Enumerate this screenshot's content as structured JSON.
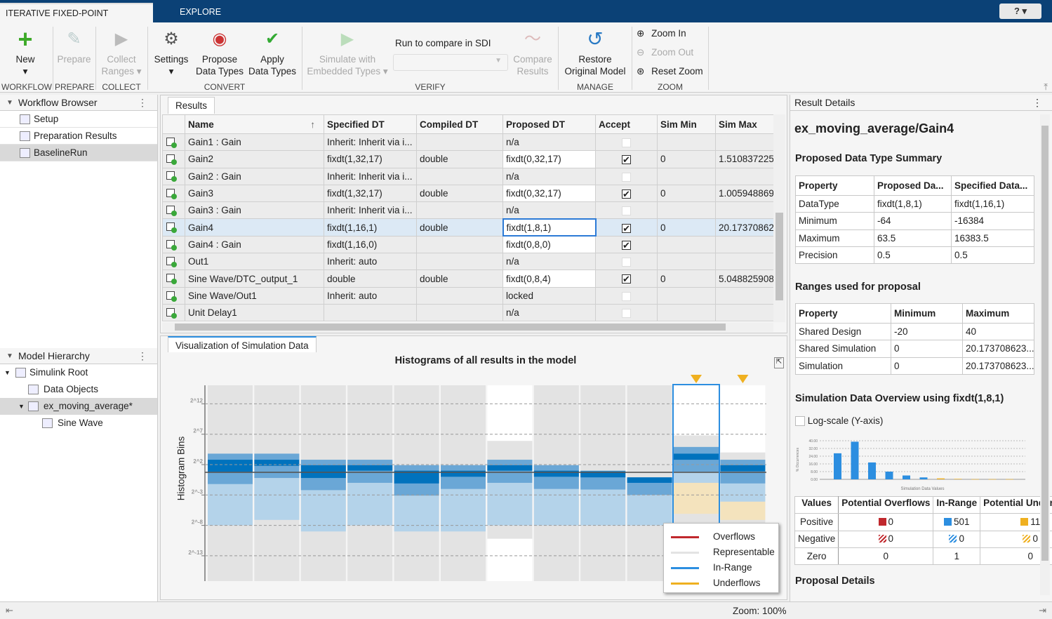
{
  "tabs": [
    "ITERATIVE FIXED-POINT CONVERSION",
    "EXPLORE"
  ],
  "help_icon": "question-icon",
  "toolstrip": {
    "buttons": [
      {
        "label1": "New",
        "label2": "▾",
        "enabled": true,
        "icon": "plus-icon"
      },
      {
        "label1": "Prepare",
        "label2": "",
        "enabled": false,
        "icon": "prepare-icon"
      },
      {
        "label1": "Collect",
        "label2": "Ranges ▾",
        "enabled": false,
        "icon": "collect-ranges-icon"
      },
      {
        "label1": "Settings",
        "label2": "▾",
        "enabled": true,
        "icon": "settings-icon"
      },
      {
        "label1": "Propose",
        "label2": "Data Types",
        "enabled": true,
        "icon": "propose-icon"
      },
      {
        "label1": "Apply",
        "label2": "Data Types",
        "enabled": true,
        "icon": "apply-icon"
      },
      {
        "label1": "Simulate with",
        "label2": "Embedded Types ▾",
        "enabled": false,
        "icon": "simulate-icon"
      },
      {
        "label1": "Compare",
        "label2": "Results",
        "enabled": false,
        "icon": "compare-icon"
      },
      {
        "label1": "Restore",
        "label2": "Original Model",
        "enabled": true,
        "icon": "restore-icon"
      }
    ],
    "run_compare_label": "Run to compare in SDI",
    "run_compare_value": "",
    "zoom": [
      "Zoom In",
      "Zoom Out",
      "Reset Zoom"
    ],
    "groups": [
      "WORKFLOW",
      "PREPARE",
      "COLLECT",
      "CONVERT",
      "VERIFY",
      "MANAGE",
      "ZOOM"
    ]
  },
  "workflow": {
    "title": "Workflow Browser",
    "items": [
      "Setup",
      "Preparation Results",
      "BaselineRun"
    ],
    "selected": 2
  },
  "hierarchy": {
    "title": "Model Hierarchy",
    "items": [
      "Simulink Root",
      "Data Objects",
      "ex_moving_average*",
      "Sine Wave"
    ],
    "selected": 2
  },
  "results": {
    "tab": "Results",
    "columns": [
      "Name",
      "Specified DT",
      "Compiled DT",
      "Proposed DT",
      "Accept",
      "Sim Min",
      "Sim Max"
    ],
    "rows": [
      [
        "Gain1 : Gain",
        "Inherit: Inherit via i...",
        "",
        "n/a",
        "disabled",
        "",
        ""
      ],
      [
        "Gain2",
        "fixdt(1,32,17)",
        "double",
        "fixdt(0,32,17)",
        "checked",
        "0",
        "1.510837225"
      ],
      [
        "Gain2 : Gain",
        "Inherit: Inherit via i...",
        "",
        "n/a",
        "disabled",
        "",
        ""
      ],
      [
        "Gain3",
        "fixdt(1,32,17)",
        "double",
        "fixdt(0,32,17)",
        "checked",
        "0",
        "1.005948869"
      ],
      [
        "Gain3 : Gain",
        "Inherit: Inherit via i...",
        "",
        "n/a",
        "disabled",
        "",
        ""
      ],
      [
        "Gain4",
        "fixdt(1,16,1)",
        "double",
        "fixdt(1,8,1)",
        "checked",
        "0",
        "20.17370862"
      ],
      [
        "Gain4 : Gain",
        "fixdt(1,16,0)",
        "",
        "fixdt(0,8,0)",
        "checked",
        "",
        ""
      ],
      [
        "Out1",
        "Inherit: auto",
        "",
        "n/a",
        "disabled",
        "",
        ""
      ],
      [
        "Sine Wave/DTC_output_1",
        "double",
        "double",
        "fixdt(0,8,4)",
        "checked",
        "0",
        "5.048825908"
      ],
      [
        "Sine Wave/Out1",
        "Inherit: auto",
        "",
        "locked",
        "disabled",
        "",
        ""
      ],
      [
        "Unit Delay1",
        "",
        "",
        "n/a",
        "disabled",
        "",
        ""
      ]
    ],
    "selected_row": 5
  },
  "viz": {
    "tab": "Visualization of Simulation Data",
    "chart_data": {
      "type": "bar",
      "title": "Histograms of all results in the model",
      "ylabel": "Histogram Bins",
      "yscale": "log2",
      "yticks": [
        {
          "exp": 12,
          "label": "2^12"
        },
        {
          "exp": 7,
          "label": "2^7"
        },
        {
          "exp": 2,
          "label": "2^2"
        },
        {
          "exp": -3,
          "label": "2^-3"
        },
        {
          "exp": -8,
          "label": "2^-8"
        },
        {
          "exp": -13,
          "label": "2^-13"
        }
      ],
      "grid": true,
      "legend_position": "bottom-right",
      "legend": [
        {
          "name": "Overflows",
          "color": "#c0282d"
        },
        {
          "name": "Representable",
          "color": "#e3e3e3"
        },
        {
          "name": "In-Range",
          "color": "#2c8ee0"
        },
        {
          "name": "Underflows",
          "color": "#efb020"
        }
      ],
      "selected_column": 10,
      "warning_columns": [
        10,
        11
      ],
      "columns": [
        {
          "representable": null,
          "in_range": [
            -8,
            3.8
          ],
          "core": [
            0.8,
            2.8
          ],
          "underflow": null
        },
        {
          "representable": null,
          "in_range": [
            -7.1,
            3.8
          ],
          "core": [
            1.8,
            2.8
          ],
          "underflow": null
        },
        {
          "representable": null,
          "in_range": [
            -9,
            2.8
          ],
          "core": [
            -0.2,
            1.9
          ],
          "underflow": null
        },
        {
          "representable": null,
          "in_range": [
            -8,
            2.8
          ],
          "core": [
            1,
            1.9
          ],
          "underflow": null
        },
        {
          "representable": null,
          "in_range": [
            -9,
            1.9
          ],
          "core": [
            -1.1,
            1
          ],
          "underflow": null
        },
        {
          "representable": null,
          "in_range": [
            -9,
            1.9
          ],
          "core": [
            0,
            1
          ],
          "underflow": null
        },
        {
          "representable": [
            -10.2,
            5.9
          ],
          "in_range": [
            -8,
            2.8
          ],
          "core": [
            1,
            1.9
          ],
          "underflow": null
        },
        {
          "representable": null,
          "in_range": [
            -8,
            1.9
          ],
          "core": [
            0,
            1
          ],
          "underflow": null
        },
        {
          "representable": null,
          "in_range": [
            -8,
            1
          ],
          "core": [
            -0.1,
            0.9
          ],
          "underflow": null
        },
        {
          "representable": null,
          "in_range": [
            -8,
            -0.1
          ],
          "core": [
            -1,
            -0.1
          ],
          "underflow": null
        },
        {
          "representable": [
            -7.6,
            6.8
          ],
          "in_range": [
            -1,
            4.9
          ],
          "core": [
            2.8,
            3.8
          ],
          "underflow": [
            -6.1,
            -1
          ]
        },
        {
          "representable": [
            -7.6,
            4
          ],
          "in_range": [
            -4.1,
            2.8
          ],
          "core": [
            0.9,
            1.9
          ],
          "underflow": [
            -7.1,
            -4.1
          ]
        }
      ]
    }
  },
  "details": {
    "title": "Result Details",
    "block": "ex_moving_average/Gain4",
    "summary_title": "Proposed Data Type Summary",
    "summary_cols": [
      "Property",
      "Proposed Da...",
      "Specified Data..."
    ],
    "summary_rows": [
      [
        "DataType",
        "fixdt(1,8,1)",
        "fixdt(1,16,1)"
      ],
      [
        "Minimum",
        "-64",
        "-16384"
      ],
      [
        "Maximum",
        "63.5",
        "16383.5"
      ],
      [
        "Precision",
        "0.5",
        "0.5"
      ]
    ],
    "ranges_title": "Ranges used for proposal",
    "ranges_cols": [
      "Property",
      "Minimum",
      "Maximum"
    ],
    "ranges_rows": [
      [
        "Shared Design",
        "-20",
        "40"
      ],
      [
        "Shared Simulation",
        "0",
        "20.173708623..."
      ],
      [
        "Simulation",
        "0",
        "20.173708623..."
      ]
    ],
    "overview_title": "Simulation Data Overview using fixdt(1,8,1)",
    "logscale_label": "Log-scale (Y-axis)",
    "logscale_checked": false,
    "mini_chart": {
      "type": "bar",
      "ylabel": "% Occurrences",
      "xlabel": "Simulation Data Values",
      "yticks": [
        "0.00",
        "8.00",
        "16.00",
        "24.00",
        "32.00",
        "40.00"
      ],
      "ylim": [
        0,
        40
      ],
      "values": [
        27,
        39,
        17.5,
        8,
        4,
        2,
        1,
        0.5,
        0.2,
        0.2,
        0.2
      ],
      "kinds": [
        "in",
        "in",
        "in",
        "in",
        "in",
        "in",
        "under",
        "under",
        "under",
        "under",
        "under"
      ]
    },
    "overview_cols": [
      "Values",
      "Potential Overflows",
      "In-Range",
      "Potential Underflows"
    ],
    "overview_rows": [
      [
        "Positive",
        "0",
        "501",
        "11"
      ],
      [
        "Negative",
        "0",
        "0",
        "0"
      ],
      [
        "Zero",
        "0",
        "1",
        "0"
      ]
    ],
    "proposal_title": "Proposal Details"
  },
  "status": {
    "zoom": "Zoom: 100%"
  },
  "colors": {
    "titlebar": "#0b4176",
    "accent": "#0072bd",
    "selection": "#2c8ee0",
    "overflow": "#c0282d",
    "underflow": "#efb020"
  }
}
